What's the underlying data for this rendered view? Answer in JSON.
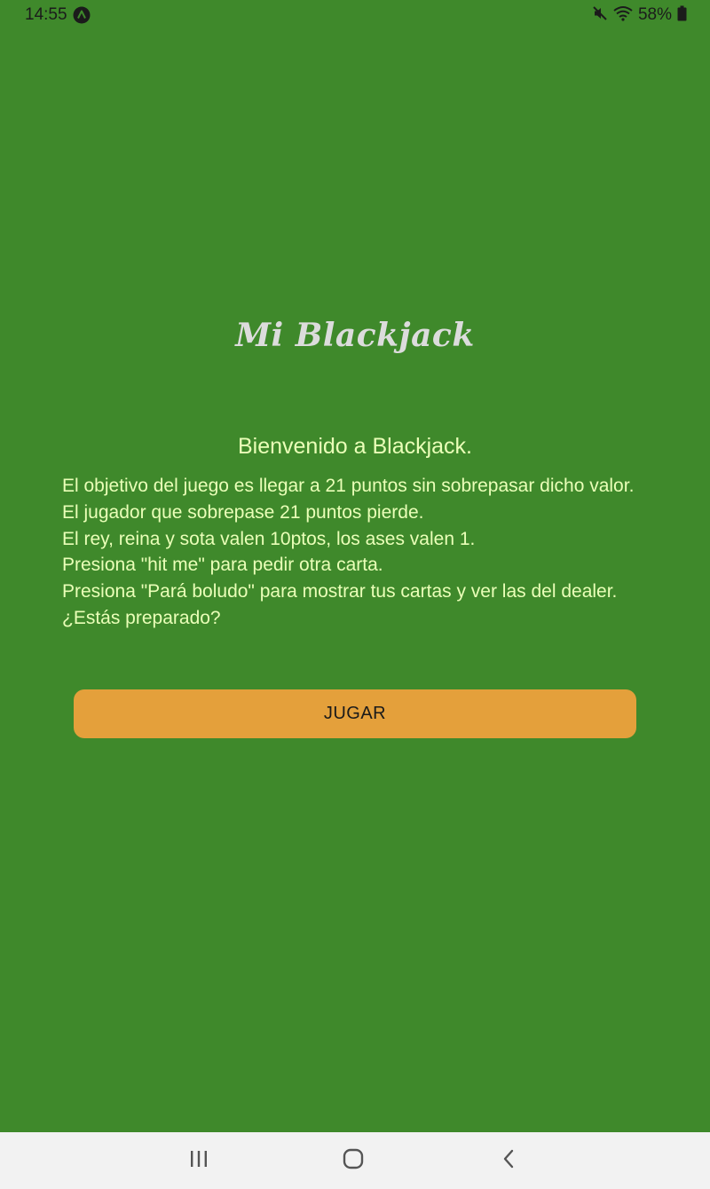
{
  "status_bar": {
    "time": "14:55",
    "battery": "58%",
    "icons": [
      "app-notification-icon",
      "mute-icon",
      "wifi-icon",
      "battery-icon"
    ]
  },
  "app": {
    "title": "Mi Blackjack",
    "welcome": "Bienvenido a Blackjack.",
    "instructions": [
      "El objetivo del juego es llegar a 21 puntos sin sobrepasar dicho valor.",
      "El jugador que sobrepase 21 puntos pierde.",
      "El rey, reina y sota valen 10ptos, los ases valen 1.",
      "Presiona \"hit me\" para pedir otra carta.",
      "Presiona \"Pará boludo\" para mostrar tus cartas y ver las del dealer.",
      "¿Estás preparado?"
    ],
    "play_button": "JUGAR"
  },
  "nav_bar": {
    "buttons": [
      "recent-apps-icon",
      "home-icon",
      "back-icon"
    ]
  },
  "colors": {
    "background": "#3f892b",
    "title_text": "#dcdcdc",
    "body_text": "#eaffb8",
    "button": "#e4a03b",
    "nav_bar": "#f2f2f2"
  }
}
